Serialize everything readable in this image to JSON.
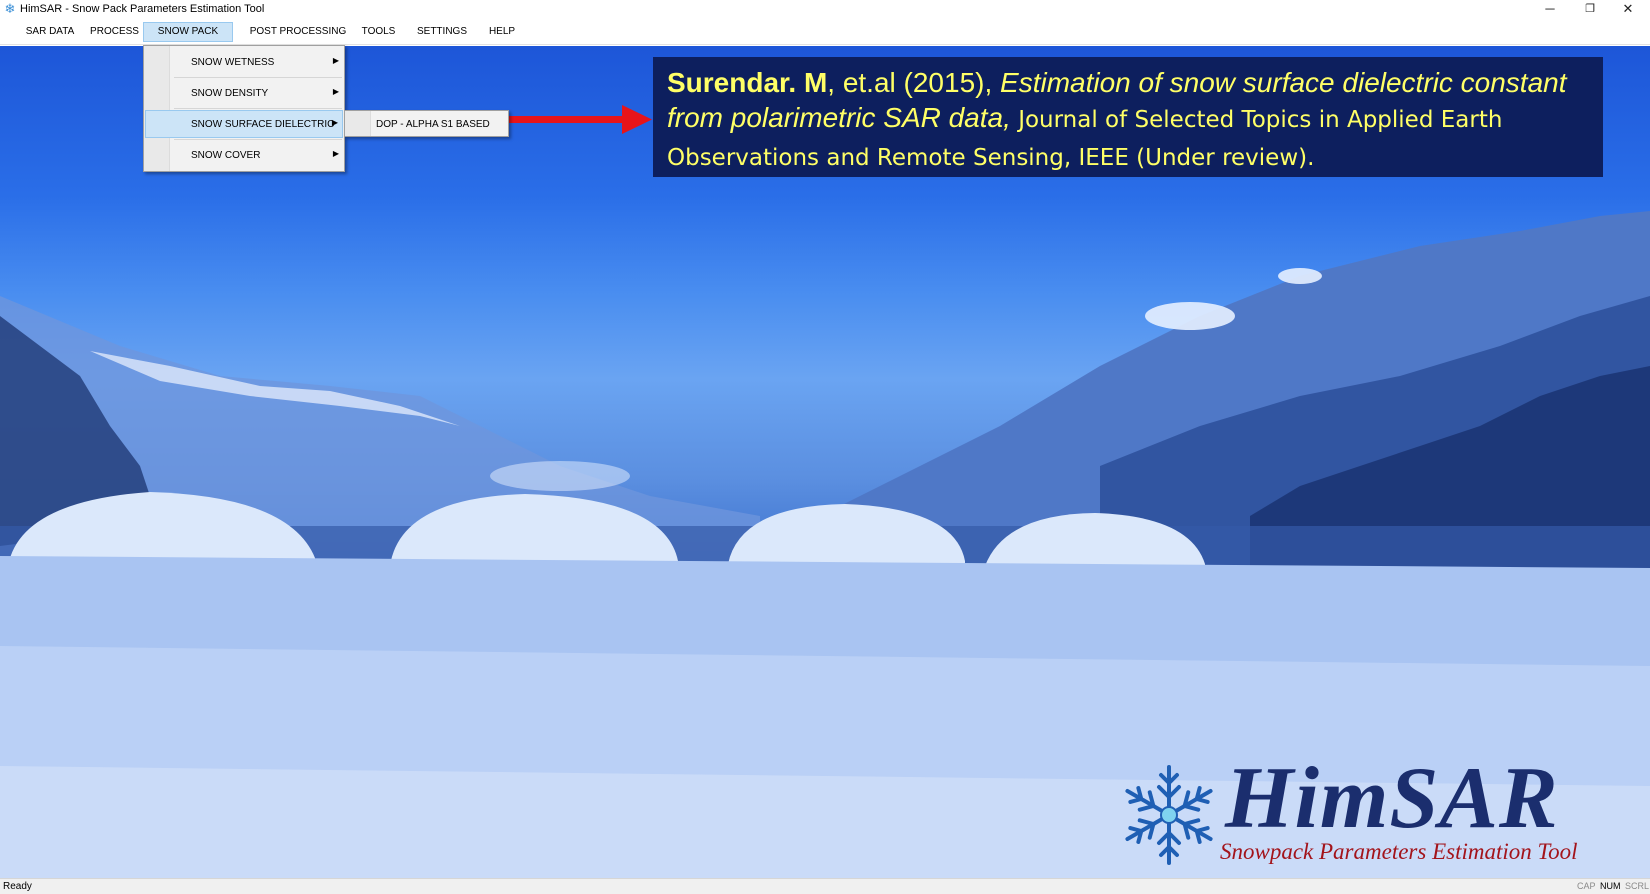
{
  "window": {
    "title": "HimSAR - Snow Pack Parameters Estimation Tool",
    "icon": "snowflake-icon",
    "controls": [
      "minimize-icon",
      "restore-icon",
      "close-icon"
    ]
  },
  "menubar": {
    "items": [
      {
        "label": "SAR DATA"
      },
      {
        "label": "PROCESS"
      },
      {
        "label": "SNOW PACK"
      },
      {
        "label": "POST PROCESSING"
      },
      {
        "label": "TOOLS"
      },
      {
        "label": "SETTINGS"
      },
      {
        "label": "HELP"
      }
    ],
    "active": "SNOW PACK"
  },
  "dropdown": {
    "items": [
      {
        "label": "SNOW WETNESS"
      },
      {
        "label": "SNOW DENSITY"
      },
      {
        "label": "SNOW SURFACE DIELECTRIC"
      },
      {
        "label": "SNOW COVER"
      }
    ],
    "highlighted": "SNOW SURFACE DIELECTRIC"
  },
  "submenu": {
    "items": [
      {
        "label": "DOP - ALPHA S1 BASED"
      }
    ]
  },
  "citation": {
    "author": "Surendar. M",
    "year_part": ", et.al (2015), ",
    "title": "Estimation of snow surface dielectric constant from polarimetric SAR data,",
    "journal": " Journal of Selected Topics in Applied Earth Observations and Remote Sensing, IEEE (Under review)."
  },
  "logo": {
    "title": "HimSAR",
    "subtitle": "Snowpack Parameters Estimation Tool"
  },
  "statusbar": {
    "status": "Ready",
    "indicators": {
      "cap": "CAP",
      "num": "NUM",
      "scrl": "SCRL"
    }
  },
  "colors": {
    "citation_bg": "#0d1f5e",
    "citation_text": "#ffff66",
    "arrow": "#e8141a",
    "logo_blue": "#1b2e6e",
    "logo_red": "#a3141b",
    "menu_highlight": "#cce4f7"
  }
}
